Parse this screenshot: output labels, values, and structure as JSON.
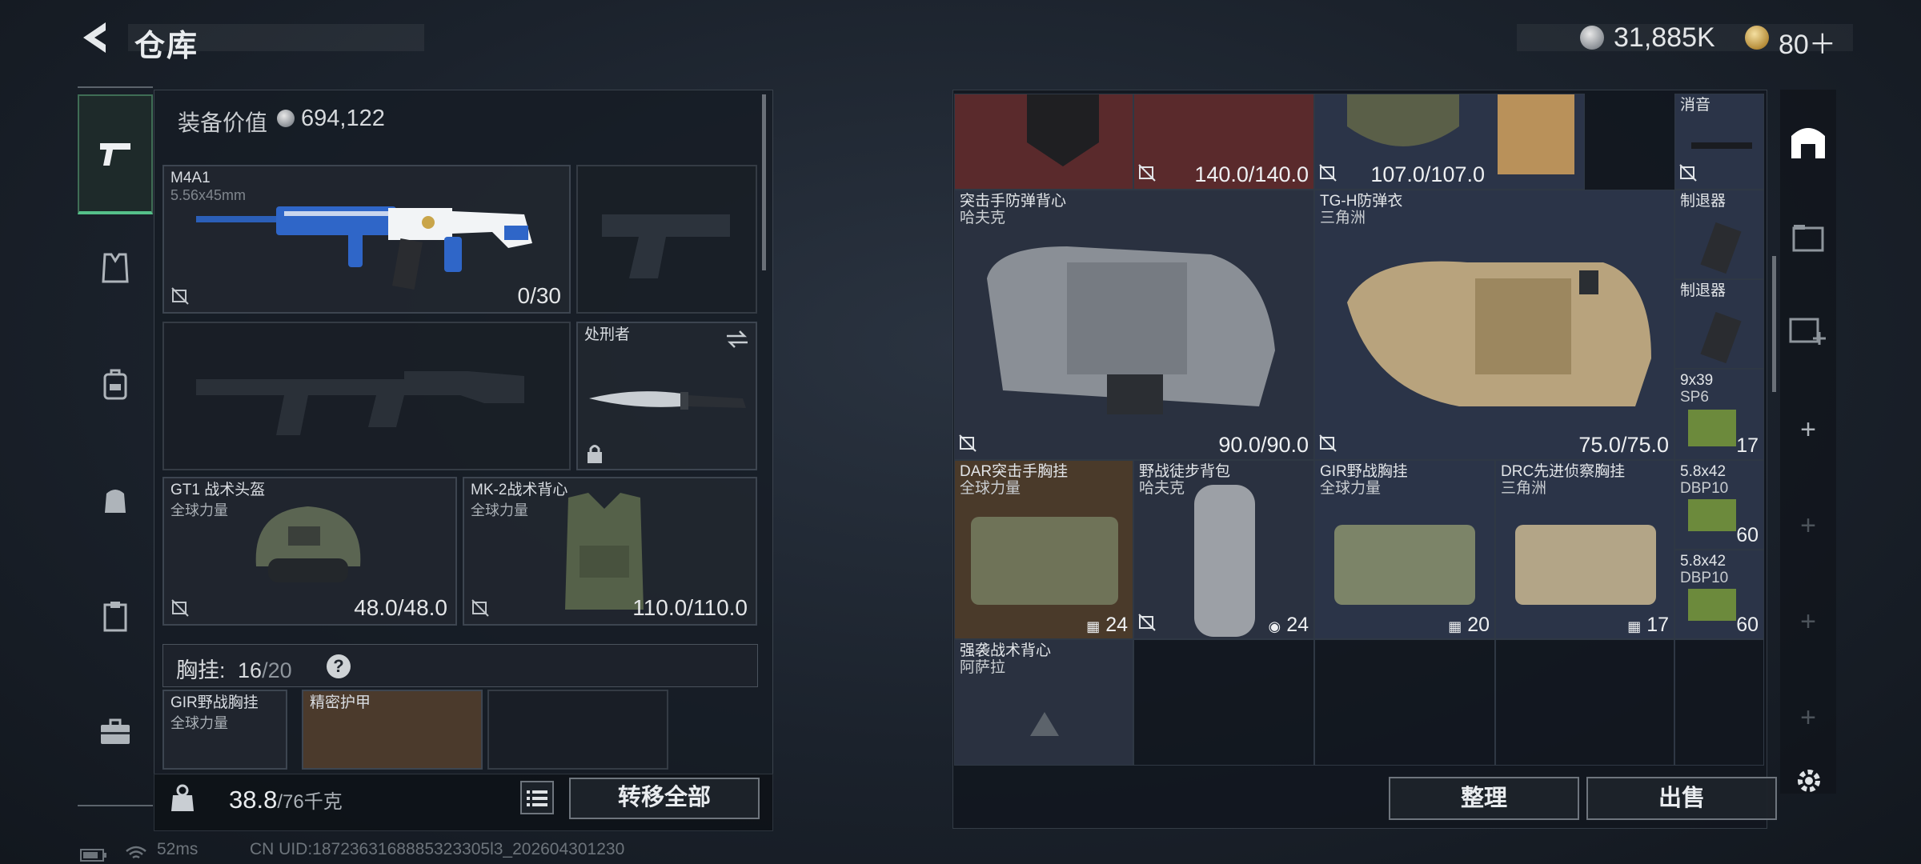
{
  "header": {
    "title": "仓库",
    "currency_silver": "31,885K",
    "currency_gold": "80＋"
  },
  "loadout": {
    "equip_value_label": "装备价值",
    "equip_value": "694,122",
    "primary": {
      "name": "M4A1",
      "caliber": "5.56x45mm",
      "ammo": "0/30"
    },
    "melee": {
      "name": "处刑者"
    },
    "helmet": {
      "name": "GT1 战术头盔",
      "brand": "全球力量",
      "durability": "48.0/48.0"
    },
    "vest": {
      "name": "MK-2战术背心",
      "brand": "全球力量",
      "durability": "110.0/110.0"
    },
    "chest_label": "胸挂:",
    "chest_used": "16",
    "chest_total": "/20",
    "chest_items": [
      {
        "name": "GIR野战胸挂",
        "brand": "全球力量"
      },
      {
        "name": "精密护甲",
        "brand": ""
      }
    ],
    "weight": "38.8",
    "weight_max": "/76千克",
    "transfer_all": "转移全部"
  },
  "stash": {
    "row0": [
      {
        "value": "140.0/140.0"
      },
      {
        "value": "107.0/107.0"
      },
      {
        "name": "消音"
      }
    ],
    "armor": [
      {
        "name": "突击手防弹背心",
        "brand": "哈夫克",
        "value": "90.0/90.0"
      },
      {
        "name": "TG-H防弹衣",
        "brand": "三角洲",
        "value": "75.0/75.0"
      }
    ],
    "small": [
      {
        "name": "制退器",
        "count": ""
      },
      {
        "name": "制退器",
        "count": ""
      },
      {
        "name": "9x39",
        "sub": "SP6",
        "count": "17"
      },
      {
        "name": "5.8x42",
        "sub": "DBP10",
        "count": "60"
      },
      {
        "name": "5.8x42",
        "sub": "DBP10",
        "count": "60"
      }
    ],
    "rigs": [
      {
        "name": "DAR突击手胸挂",
        "brand": "全球力量",
        "count": "24"
      },
      {
        "name": "野战徒步背包",
        "brand": "哈夫克",
        "count": "24"
      },
      {
        "name": "GIR野战胸挂",
        "brand": "全球力量",
        "count": "20"
      },
      {
        "name": "DRC先进侦察胸挂",
        "brand": "三角洲",
        "count": "17"
      }
    ],
    "last": {
      "name": "强袭战术背心",
      "brand": "阿萨拉"
    },
    "sort_button": "整理",
    "sell_button": "出售"
  },
  "footer": {
    "ping": "52ms",
    "uid": "CN UID:1872363168885323305l3_202604301230"
  },
  "colors": {
    "accent": "#55c08a",
    "red_cell": "#5a2a2c",
    "blue_cell": "#2b3448",
    "brown_cell": "#4a3a2a"
  }
}
